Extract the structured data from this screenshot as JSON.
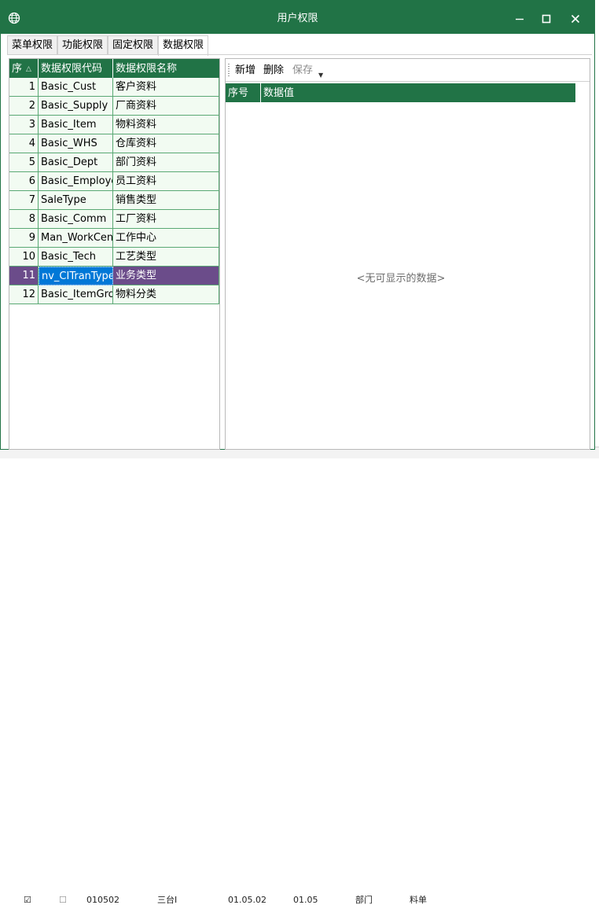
{
  "window": {
    "title": "用户权限",
    "app_icon": "globe-icon",
    "buttons": [
      "minimize-icon",
      "maximize-icon",
      "close-icon"
    ],
    "accent_color": "#217346"
  },
  "tabs": [
    {
      "label": "菜单权限",
      "active": false
    },
    {
      "label": "功能权限",
      "active": false
    },
    {
      "label": "固定权限",
      "active": false
    },
    {
      "label": "数据权限",
      "active": true
    }
  ],
  "left_grid": {
    "columns": [
      "序",
      "数据权限代码",
      "数据权限名称"
    ],
    "sort_icon": "sort-up-icon",
    "rows": [
      {
        "no": "1",
        "code": "Basic_Cust",
        "name": "客户资料"
      },
      {
        "no": "2",
        "code": "Basic_Supply",
        "name": "厂商资料"
      },
      {
        "no": "3",
        "code": "Basic_Item",
        "name": "物料资料"
      },
      {
        "no": "4",
        "code": "Basic_WHS",
        "name": "仓库资料"
      },
      {
        "no": "5",
        "code": "Basic_Dept",
        "name": "部门资料"
      },
      {
        "no": "6",
        "code": "Basic_Employe",
        "name": "员工资料"
      },
      {
        "no": "7",
        "code": "SaleType",
        "name": "销售类型"
      },
      {
        "no": "8",
        "code": "Basic_Comm",
        "name": "工厂资料"
      },
      {
        "no": "9",
        "code": "Man_WorkCen",
        "name": "工作中心"
      },
      {
        "no": "10",
        "code": "Basic_Tech",
        "name": "工艺类型"
      },
      {
        "no": "11",
        "code": "nv_CITranType",
        "name": "业务类型"
      },
      {
        "no": "12",
        "code": "Basic_ItemGro",
        "name": "物料分类"
      }
    ],
    "selected_row": 11,
    "selection_color": "#6b4c8a"
  },
  "toolbar": {
    "add_label": "新增",
    "delete_label": "删除",
    "save_label": "保存"
  },
  "right_grid": {
    "columns": [
      "序号",
      "数据值"
    ],
    "empty_text": "<无可显示的数据>"
  },
  "background": {
    "cells": [
      "010502",
      "三台I",
      "01.05.02",
      "01.05",
      "部门",
      "料单"
    ]
  }
}
